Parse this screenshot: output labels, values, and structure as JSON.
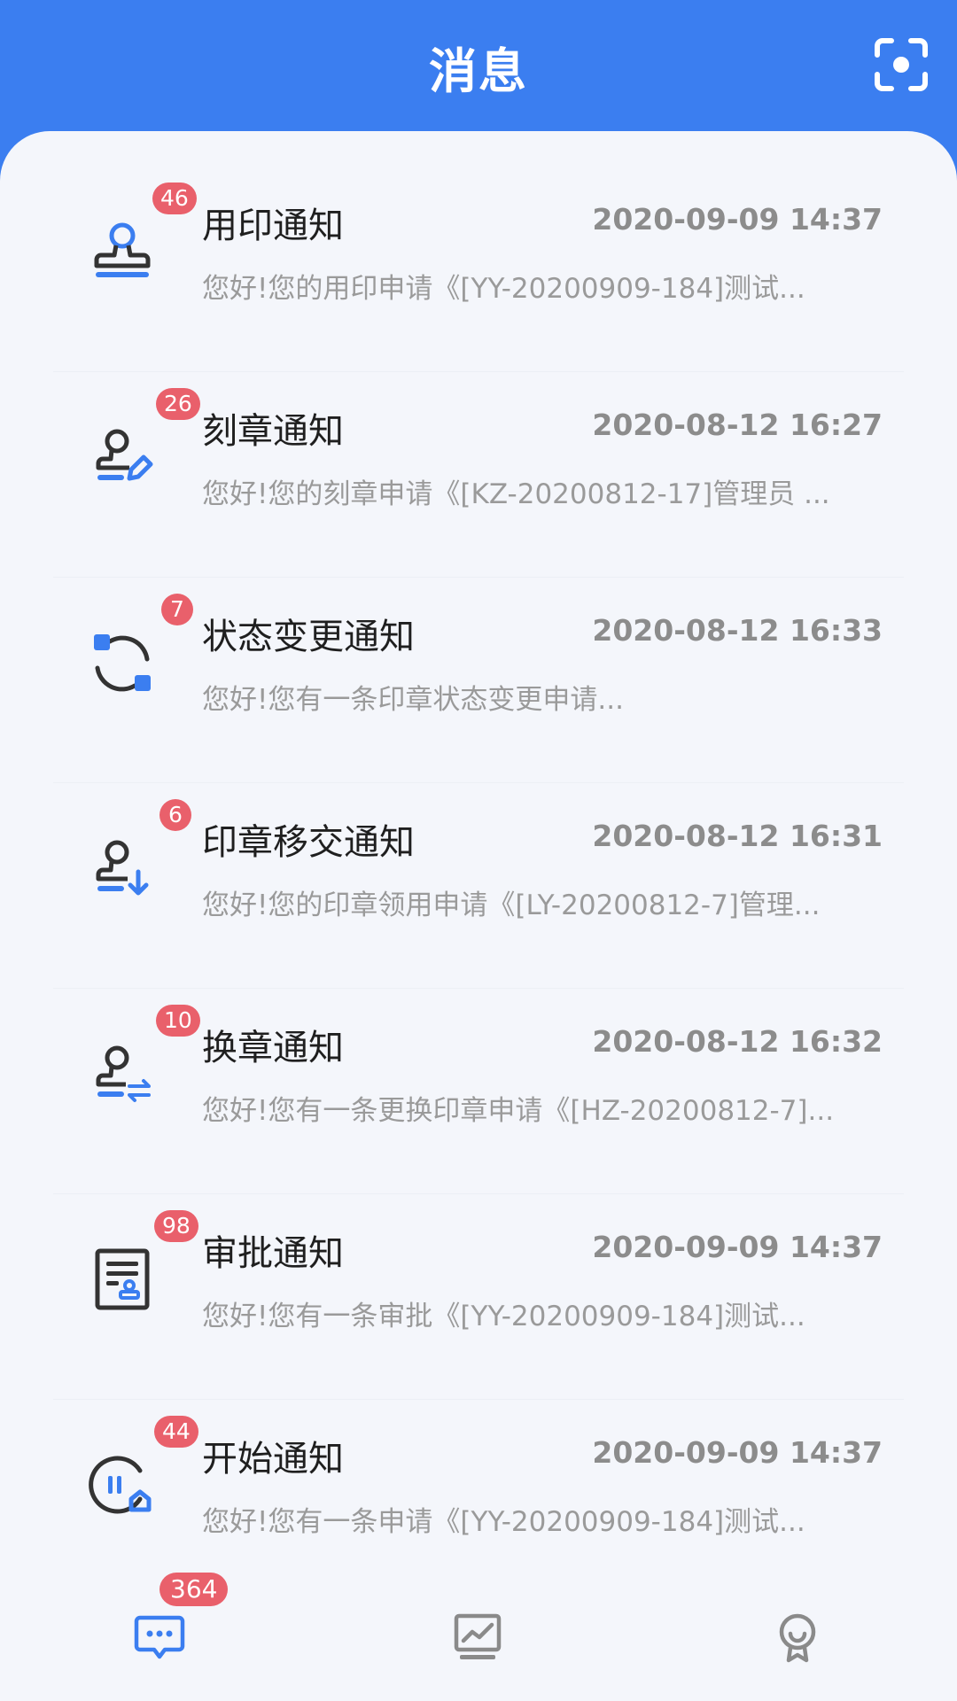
{
  "header": {
    "title": "消息"
  },
  "messages": [
    {
      "icon": "stamp-icon",
      "badge": "46",
      "title": "用印通知",
      "time": "2020-09-09 14:37",
      "preview": "您好!您的用印申请《[YY-20200909-184]测试..."
    },
    {
      "icon": "stamp-edit-icon",
      "badge": "26",
      "title": "刻章通知",
      "time": "2020-08-12 16:27",
      "preview": "您好!您的刻章申请《[KZ-20200812-17]管理员 ..."
    },
    {
      "icon": "status-change-icon",
      "badge": "7",
      "title": "状态变更通知",
      "time": "2020-08-12 16:33",
      "preview": "您好!您有一条印章状态变更申请..."
    },
    {
      "icon": "stamp-transfer-icon",
      "badge": "6",
      "title": "印章移交通知",
      "time": "2020-08-12 16:31",
      "preview": "您好!您的印章领用申请《[LY-20200812-7]管理..."
    },
    {
      "icon": "stamp-exchange-icon",
      "badge": "10",
      "title": "换章通知",
      "time": "2020-08-12 16:32",
      "preview": "您好!您有一条更换印章申请《[HZ-20200812-7]..."
    },
    {
      "icon": "approval-document-icon",
      "badge": "98",
      "title": "审批通知",
      "time": "2020-09-09 14:37",
      "preview": "您好!您有一条审批《[YY-20200909-184]测试..."
    },
    {
      "icon": "start-icon",
      "badge": "44",
      "title": "开始通知",
      "time": "2020-09-09 14:37",
      "preview": "您好!您有一条申请《[YY-20200909-184]测试..."
    }
  ],
  "tabbar": {
    "badge": "364",
    "tabs": [
      {
        "icon": "message-icon",
        "active": true
      },
      {
        "icon": "chart-icon",
        "active": false
      },
      {
        "icon": "profile-icon",
        "active": false
      }
    ]
  },
  "colors": {
    "primary": "#3b7ef0",
    "badge": "#e9606b",
    "background": "#f4f6fb"
  }
}
